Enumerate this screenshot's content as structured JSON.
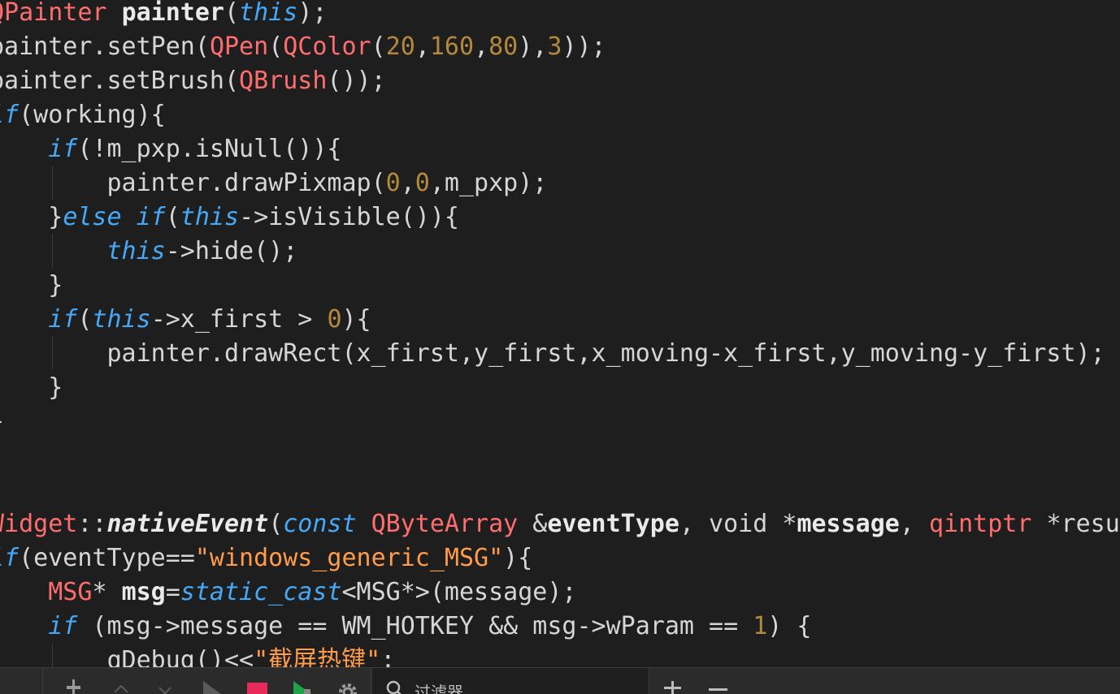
{
  "editor": {
    "lines": [
      [
        [
          "QPainter ",
          "t-ty"
        ],
        [
          "painter",
          "t-def"
        ],
        [
          "(",
          "t-op"
        ],
        [
          "this",
          "t-kw"
        ],
        [
          ");",
          "t-op"
        ]
      ],
      [
        [
          "painter.setPen(",
          "t-op"
        ],
        [
          "QPen",
          "t-ty"
        ],
        [
          "(",
          "t-op"
        ],
        [
          "QColor",
          "t-ty"
        ],
        [
          "(",
          "t-op"
        ],
        [
          "20",
          "t-num"
        ],
        [
          ",",
          "t-op"
        ],
        [
          "160",
          "t-num"
        ],
        [
          ",",
          "t-op"
        ],
        [
          "80",
          "t-num"
        ],
        [
          "),",
          "t-op"
        ],
        [
          "3",
          "t-num"
        ],
        [
          "));",
          "t-op"
        ]
      ],
      [
        [
          "painter.setBrush(",
          "t-op"
        ],
        [
          "QBrush",
          "t-ty"
        ],
        [
          "());",
          "t-op"
        ]
      ],
      [
        [
          "if",
          "t-kw"
        ],
        [
          "(working){",
          "t-op"
        ]
      ],
      [
        [
          "    ",
          "t-op"
        ],
        [
          "if",
          "t-kw"
        ],
        [
          "(!m_pxp.isNull()){",
          "t-op"
        ]
      ],
      [
        [
          "        painter.drawPixmap(",
          "t-op"
        ],
        [
          "0",
          "t-num"
        ],
        [
          ",",
          "t-op"
        ],
        [
          "0",
          "t-num"
        ],
        [
          ",m_pxp);",
          "t-op"
        ]
      ],
      [
        [
          "    }",
          "t-op"
        ],
        [
          "else if",
          "t-kw"
        ],
        [
          "(",
          "t-op"
        ],
        [
          "this",
          "t-kw"
        ],
        [
          "->isVisible()){",
          "t-op"
        ]
      ],
      [
        [
          "        ",
          "t-op"
        ],
        [
          "this",
          "t-kw"
        ],
        [
          "->hide();",
          "t-op"
        ]
      ],
      [
        [
          "    }",
          "t-op"
        ]
      ],
      [
        [
          "    ",
          "t-op"
        ],
        [
          "if",
          "t-kw"
        ],
        [
          "(",
          "t-op"
        ],
        [
          "this",
          "t-kw"
        ],
        [
          "->x_first > ",
          "t-op"
        ],
        [
          "0",
          "t-num"
        ],
        [
          "){",
          "t-op"
        ]
      ],
      [
        [
          "        painter.drawRect(x_first,y_first,x_moving-x_first,y_moving-y_first);",
          "t-op"
        ]
      ],
      [
        [
          "    }",
          "t-op"
        ]
      ],
      [
        [
          "}",
          "t-op"
        ]
      ],
      [],
      [],
      [
        [
          "Widget",
          "t-ty"
        ],
        [
          "::",
          "t-op"
        ],
        [
          "nativeEvent",
          "t-fn"
        ],
        [
          "(",
          "t-op"
        ],
        [
          "const",
          "t-kw"
        ],
        [
          " ",
          "t-op"
        ],
        [
          "QByteArray",
          "t-ty"
        ],
        [
          " &",
          "t-op"
        ],
        [
          "eventType",
          "t-def"
        ],
        [
          ", void *",
          "t-op"
        ],
        [
          "message",
          "t-def"
        ],
        [
          ", ",
          "t-op"
        ],
        [
          "qintptr",
          "t-ty"
        ],
        [
          " *result)",
          "t-op"
        ]
      ],
      [
        [
          "if",
          "t-kw"
        ],
        [
          "(eventType==",
          "t-op"
        ],
        [
          "\"windows_generic_MSG\"",
          "t-str"
        ],
        [
          "){",
          "t-op"
        ]
      ],
      [
        [
          "    ",
          "t-op"
        ],
        [
          "MSG",
          "t-ty"
        ],
        [
          "* ",
          "t-op"
        ],
        [
          "msg",
          "t-def"
        ],
        [
          "=",
          "t-op"
        ],
        [
          "static_cast",
          "t-kw"
        ],
        [
          "<MSG*>(message);",
          "t-op"
        ]
      ],
      [
        [
          "    ",
          "t-op"
        ],
        [
          "if",
          "t-kw"
        ],
        [
          " (msg->message == WM_HOTKEY && msg->wParam == ",
          "t-op"
        ],
        [
          "1",
          "t-num"
        ],
        [
          ") {",
          "t-op"
        ]
      ],
      [
        [
          "        qDebug()<<",
          "t-op"
        ],
        [
          "\"截屏热键\"",
          "t-str"
        ],
        [
          ";",
          "t-op"
        ]
      ]
    ]
  },
  "toolbar": {
    "filter_placeholder": "过滤器"
  },
  "colors": {
    "background": "#1e1e1e",
    "keyword": "#45a9f9",
    "type": "#ff6e6e",
    "number": "#b5893b",
    "string": "#ff9c4a",
    "stop": "#e8295a",
    "run": "#1fa34a"
  },
  "icons": [
    "hammer-icon",
    "up-arrow-icon",
    "clear-icon",
    "play-icon",
    "stop-icon",
    "run-debug-icon",
    "gear-icon",
    "search-icon",
    "add-icon",
    "minus-icon"
  ]
}
